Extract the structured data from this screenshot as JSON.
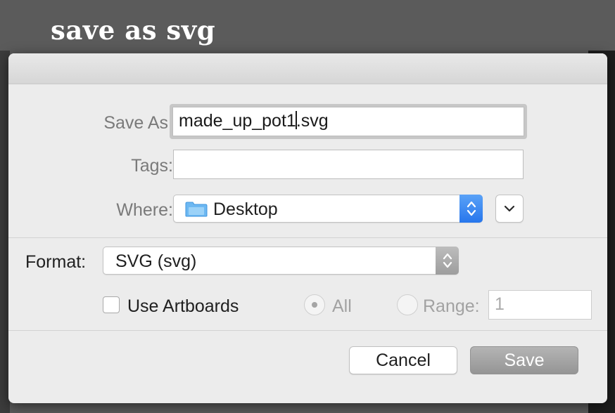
{
  "background": {
    "title": "save as svg"
  },
  "dialog": {
    "save_as": {
      "label": "Save As:",
      "filename_before_caret": "made_up_pot1",
      "filename_after_caret": ".svg"
    },
    "tags": {
      "label": "Tags:",
      "value": ""
    },
    "where": {
      "label": "Where:",
      "location": "Desktop",
      "location_icon": "folder-icon"
    },
    "format": {
      "label": "Format:",
      "selected": "SVG (svg)"
    },
    "use_artboards": {
      "label": "Use Artboards",
      "checked": false
    },
    "artboard_range": {
      "all_label": "All",
      "all_selected": true,
      "range_label": "Range:",
      "range_value": "1",
      "enabled": false
    },
    "buttons": {
      "cancel": "Cancel",
      "save": "Save"
    }
  },
  "colors": {
    "window_backdrop": "#5b5b5b",
    "dialog_background": "#ececec",
    "accent_blue": "#2f7df0",
    "folder_blue": "#6cb8f2"
  }
}
